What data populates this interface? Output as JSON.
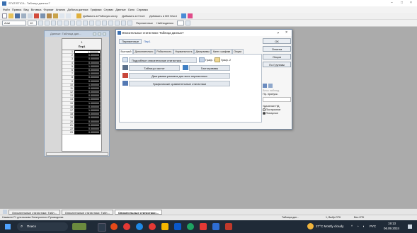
{
  "window": {
    "title": "STATISTICA - Таблица данных7"
  },
  "menu": [
    "Файл",
    "Правка",
    "Вид",
    "Вставка",
    "Формат",
    "Анализ",
    "Добыча данных",
    "Графики",
    "Сервис",
    "Данные",
    "Окно",
    "Справка"
  ],
  "toolbar": {
    "link1": "Добавить в Рабочую книгу",
    "link2": "Добавить в Отчет",
    "link3": "Добавить в MS Word",
    "font_family": "Arial",
    "font_size": "10",
    "variables_btn": "Переменные",
    "observations_btn": "Наблюдения"
  },
  "sheet": {
    "title": "Данные: Таблица дан...",
    "column_num": "1",
    "column_name": "Пер1",
    "rows": [
      {
        "n": "1",
        "v": "1.000000"
      },
      {
        "n": "2",
        "v": "0.000000"
      },
      {
        "n": "3",
        "v": "0.000000"
      },
      {
        "n": "4",
        "v": "0.000000"
      },
      {
        "n": "5",
        "v": "1.000000"
      },
      {
        "n": "6",
        "v": "0.000000"
      },
      {
        "n": "7",
        "v": "1.000000"
      },
      {
        "n": "8",
        "v": "0.000000"
      },
      {
        "n": "9",
        "v": "0.000000"
      },
      {
        "n": "10",
        "v": "1.000000"
      },
      {
        "n": "11",
        "v": "0.000000"
      },
      {
        "n": "12",
        "v": "0.000000"
      },
      {
        "n": "13",
        "v": "0.000000"
      },
      {
        "n": "14",
        "v": "1.000000"
      },
      {
        "n": "15",
        "v": "1.000000"
      },
      {
        "n": "16",
        "v": "0.000000"
      },
      {
        "n": "17",
        "v": "1.000000"
      },
      {
        "n": "18",
        "v": "0.000000"
      },
      {
        "n": "19",
        "v": "0.000000"
      },
      {
        "n": "20",
        "v": "0.000000"
      },
      {
        "n": "21",
        "v": "0.000000"
      },
      {
        "n": "22",
        "v": "0.000000"
      },
      {
        "n": "23",
        "v": "0.000000"
      }
    ]
  },
  "dialog": {
    "title": "Описательные статистики: Таблица данных7",
    "help": "?",
    "close": "×",
    "variables_btn": "Переменные",
    "variable_value": "Пер1",
    "tabs": [
      "Быстрый",
      "Дополнительно",
      "Робастность",
      "Нормальность",
      "Диаграммы",
      "Катег. графики",
      "Опции"
    ],
    "active_tab": 0,
    "summary_btn": "Подробные описательные статистики",
    "group1": "Граф. 1",
    "group2": "Граф. 2",
    "freq_tables_btn": "Таблицы частот",
    "histograms_btn": "Гистограммы",
    "box_whisker_btn": "Диаграмма размаха для всех переменных",
    "graphs_compare_btn": "Графические сравнительные статистики",
    "ok": "ОК",
    "cancel": "Отмена",
    "options": "Опции",
    "by_groups": "По Группам",
    "weights_label": "Веса наблюд.",
    "cases_label": "Пр. пропуск.",
    "mode_label": "Удаление ПД",
    "radio_listwise": "Построчное",
    "radio_pairwise": "Попарное"
  },
  "bottom_tabs": [
    "Описательные статистики: Табл...",
    "Описательные статистики: Табл...",
    "Описательные статистики:..."
  ],
  "status": {
    "left": "Нажмите F1 для вызова Электронного Руководства",
    "right1": "Таблица дан...",
    "right2": "1, Выбр:ОТК",
    "right3": "Вес:ОТК"
  },
  "taskbar": {
    "search_placeholder": "Поиск",
    "weather": "27°C Mostly cloudy",
    "lang": "РУС",
    "time": "19:13",
    "date": "06.09.2024"
  }
}
